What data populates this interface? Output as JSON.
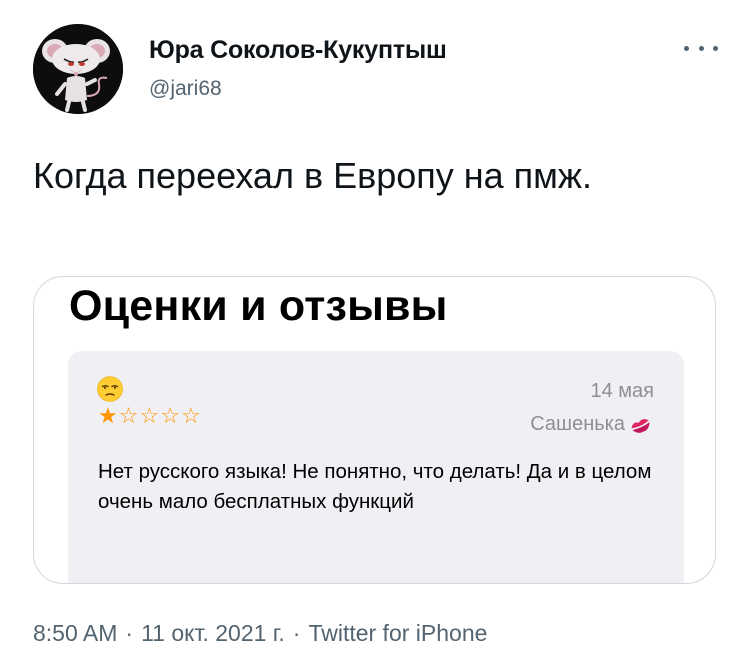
{
  "tweet": {
    "author": {
      "display_name": "Юра Соколов-Кукуптыш",
      "handle": "@jari68",
      "avatar_icon": "cartoon-mouse-avatar"
    },
    "more_icon": "more-horizontal-icon",
    "text": "Когда переехал в Европу на пмж.",
    "media": {
      "title": "Оценки и отзывы",
      "review": {
        "emoji_icon": "unamused-face-emoji",
        "date": "14 мая",
        "rating": 1,
        "rating_max": 5,
        "stars": [
          "★",
          "☆",
          "☆",
          "☆",
          "☆"
        ],
        "reviewer": "Сашенька",
        "reviewer_icon": "kiss-mark-emoji",
        "text": "Нет русского языка! Не понятно, что делать! Да и в целом очень мало бесплатных функций"
      }
    },
    "meta": {
      "time": "8:50 AM",
      "separator": "·",
      "date_day": "11",
      "date_month": "окт.",
      "date_year": "2021 г.",
      "source": "Twitter for iPhone"
    }
  },
  "colors": {
    "text_primary": "#0f1419",
    "text_secondary": "#536471",
    "card_border": "#cfd9de",
    "review_bg": "#f0f0f4",
    "star": "#ff9500",
    "review_meta": "#8e8e93"
  }
}
